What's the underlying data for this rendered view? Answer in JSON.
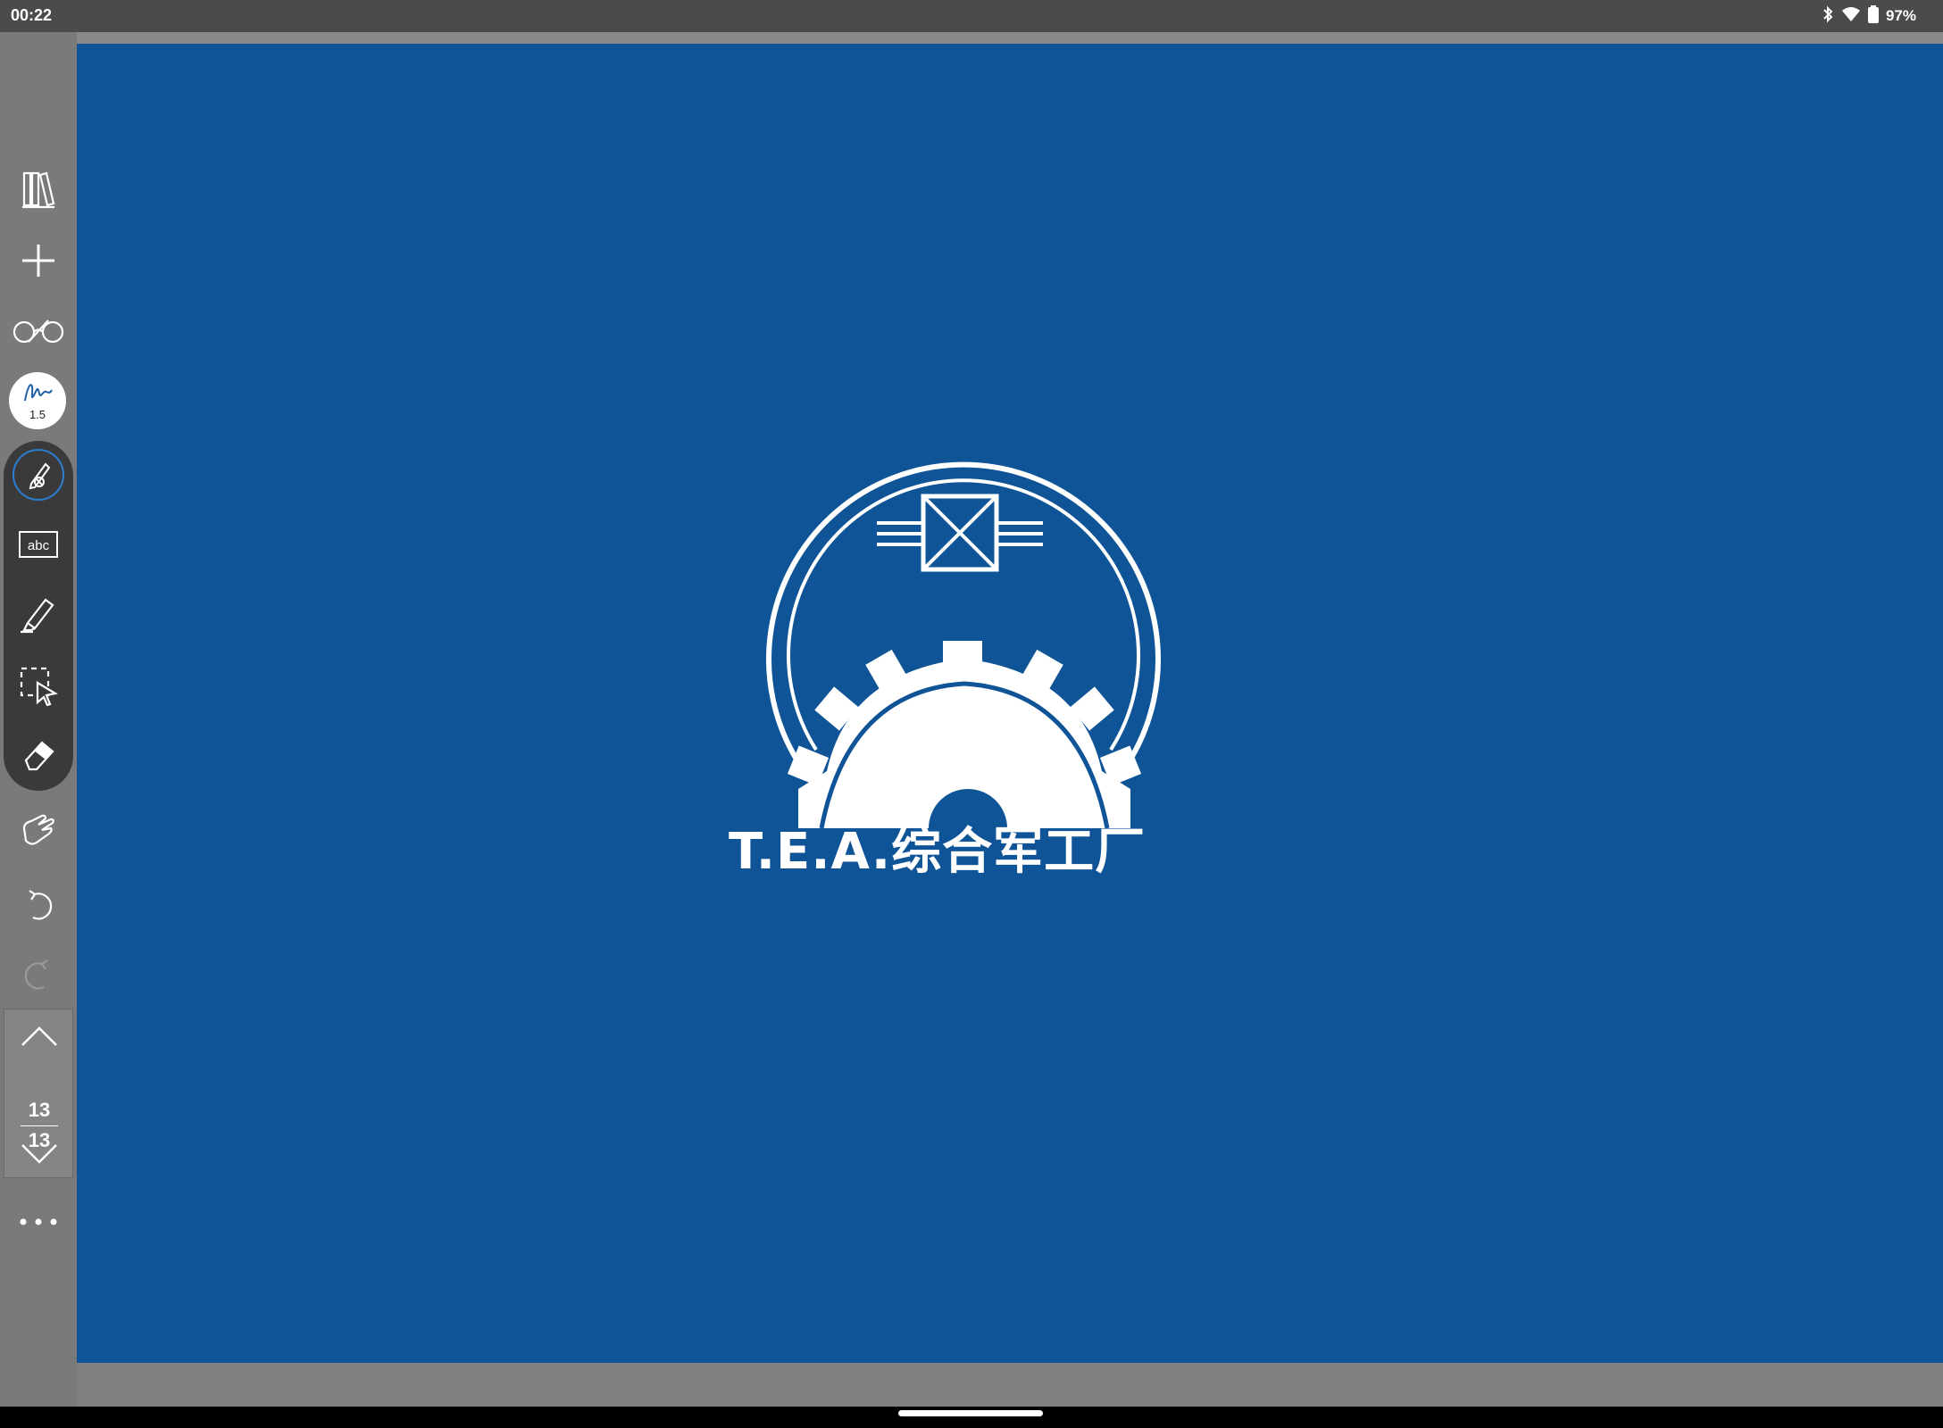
{
  "status_bar": {
    "time": "00:22",
    "battery_percent": "97%",
    "icons": [
      "bluetooth-icon",
      "wifi-icon",
      "battery-icon"
    ]
  },
  "toolbar": {
    "tools": [
      "library-icon",
      "add-icon",
      "reading-mode-icon",
      "pen-size-icon",
      "pen-tool-icon",
      "text-tool-icon",
      "highlighter-icon",
      "lasso-select-icon",
      "eraser-icon",
      "hand-tool-icon",
      "undo-icon",
      "redo-icon"
    ],
    "pen_size": "1.5",
    "active_tool": "pen-tool"
  },
  "page_nav": {
    "current_page": "13",
    "total_pages": "13"
  },
  "document": {
    "company_name": "T.E.A.综合军工厂",
    "background_color": "#0f5497",
    "logo": "gear-emblem-logo"
  },
  "colors": {
    "status_bar": "#4b4b4b",
    "toolbar": "#7a7a7a",
    "pen_group": "#3a3a3a",
    "accent_blue": "#2a7fd4"
  }
}
